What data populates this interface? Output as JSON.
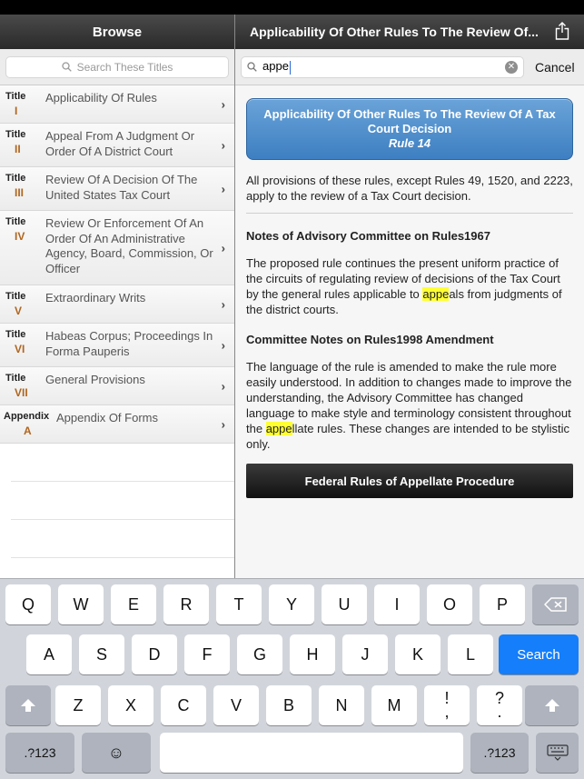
{
  "left": {
    "title": "Browse",
    "search_placeholder": "Search These Titles",
    "items": [
      {
        "kind": "Title",
        "num": "I",
        "label": "Applicability Of Rules"
      },
      {
        "kind": "Title",
        "num": "II",
        "label": "Appeal From A Judgment Or Order Of A District Court"
      },
      {
        "kind": "Title",
        "num": "III",
        "label": "Review Of A Decision Of The United States Tax Court"
      },
      {
        "kind": "Title",
        "num": "IV",
        "label": "Review Or Enforcement Of An Order Of An Administrative Agency, Board, Commission, Or Officer"
      },
      {
        "kind": "Title",
        "num": "V",
        "label": "Extraordinary Writs"
      },
      {
        "kind": "Title",
        "num": "VI",
        "label": "Habeas Corpus; Proceedings In Forma Pauperis"
      },
      {
        "kind": "Title",
        "num": "VII",
        "label": "General Provisions"
      },
      {
        "kind": "Appendix",
        "num": "A",
        "label": "Appendix Of Forms"
      }
    ]
  },
  "right": {
    "title": "Applicability Of Other Rules To The Review Of...",
    "search_value": "appe",
    "cancel_label": "Cancel",
    "rule_title": "Applicability Of Other Rules To The Review Of A Tax Court Decision",
    "rule_number": "Rule 14",
    "body_text": "All provisions of these rules, except Rules 49, 1520, and 2223, apply to the review of a Tax Court decision.",
    "heading1": "Notes of Advisory Committee on Rules1967",
    "para1_a": "The proposed rule continues the present uniform practice of the circuits of regulating review of decisions of the Tax Court by the general rules applicable to ",
    "para1_hl": "appe",
    "para1_b": "als from judgments of the district courts.",
    "heading2": "Committee Notes on Rules1998 Amendment",
    "para2_a": "The language of the rule is amended to make the rule more easily understood. In addition to changes made to improve the understanding, the Advisory Committee has changed language to make style and terminology consistent throughout the ",
    "para2_hl": "appe",
    "para2_b": "llate rules. These changes are intended to be stylistic only.",
    "footer_button": "Federal Rules of Appellate Procedure"
  },
  "keyboard": {
    "row1": [
      "Q",
      "W",
      "E",
      "R",
      "T",
      "Y",
      "U",
      "I",
      "O",
      "P"
    ],
    "row2": [
      "A",
      "S",
      "D",
      "F",
      "G",
      "H",
      "J",
      "K",
      "L"
    ],
    "row3": [
      "Z",
      "X",
      "C",
      "V",
      "B",
      "N",
      "M",
      "!",
      "?"
    ],
    "row3_sub": [
      "",
      "",
      "",
      "",
      "",
      "",
      "",
      ",",
      "."
    ],
    "search_label": "Search",
    "numbers_label": ".?123",
    "emoji": "☺"
  }
}
